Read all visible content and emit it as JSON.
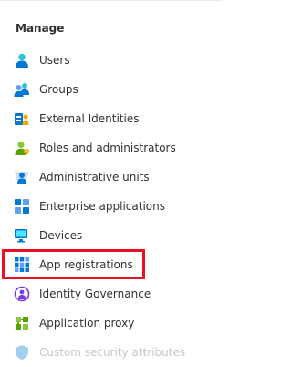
{
  "manage": {
    "header": "Manage",
    "items": [
      {
        "label": "Users",
        "icon": "user-icon"
      },
      {
        "label": "Groups",
        "icon": "group-icon"
      },
      {
        "label": "External Identities",
        "icon": "external-identities-icon"
      },
      {
        "label": "Roles and administrators",
        "icon": "roles-icon"
      },
      {
        "label": "Administrative units",
        "icon": "administrative-units-icon"
      },
      {
        "label": "Enterprise applications",
        "icon": "enterprise-apps-icon"
      },
      {
        "label": "Devices",
        "icon": "devices-icon"
      },
      {
        "label": "App registrations",
        "icon": "app-registrations-icon"
      },
      {
        "label": "Identity Governance",
        "icon": "identity-governance-icon"
      },
      {
        "label": "Application proxy",
        "icon": "application-proxy-icon"
      },
      {
        "label": "Custom security attributes",
        "icon": "custom-security-attributes-icon"
      }
    ]
  },
  "annotation": {
    "highlight_color": "#e81123"
  },
  "colors": {
    "accent_blue": "#0078d4",
    "text": "#323130",
    "faded_text": "#c8c6c4"
  }
}
